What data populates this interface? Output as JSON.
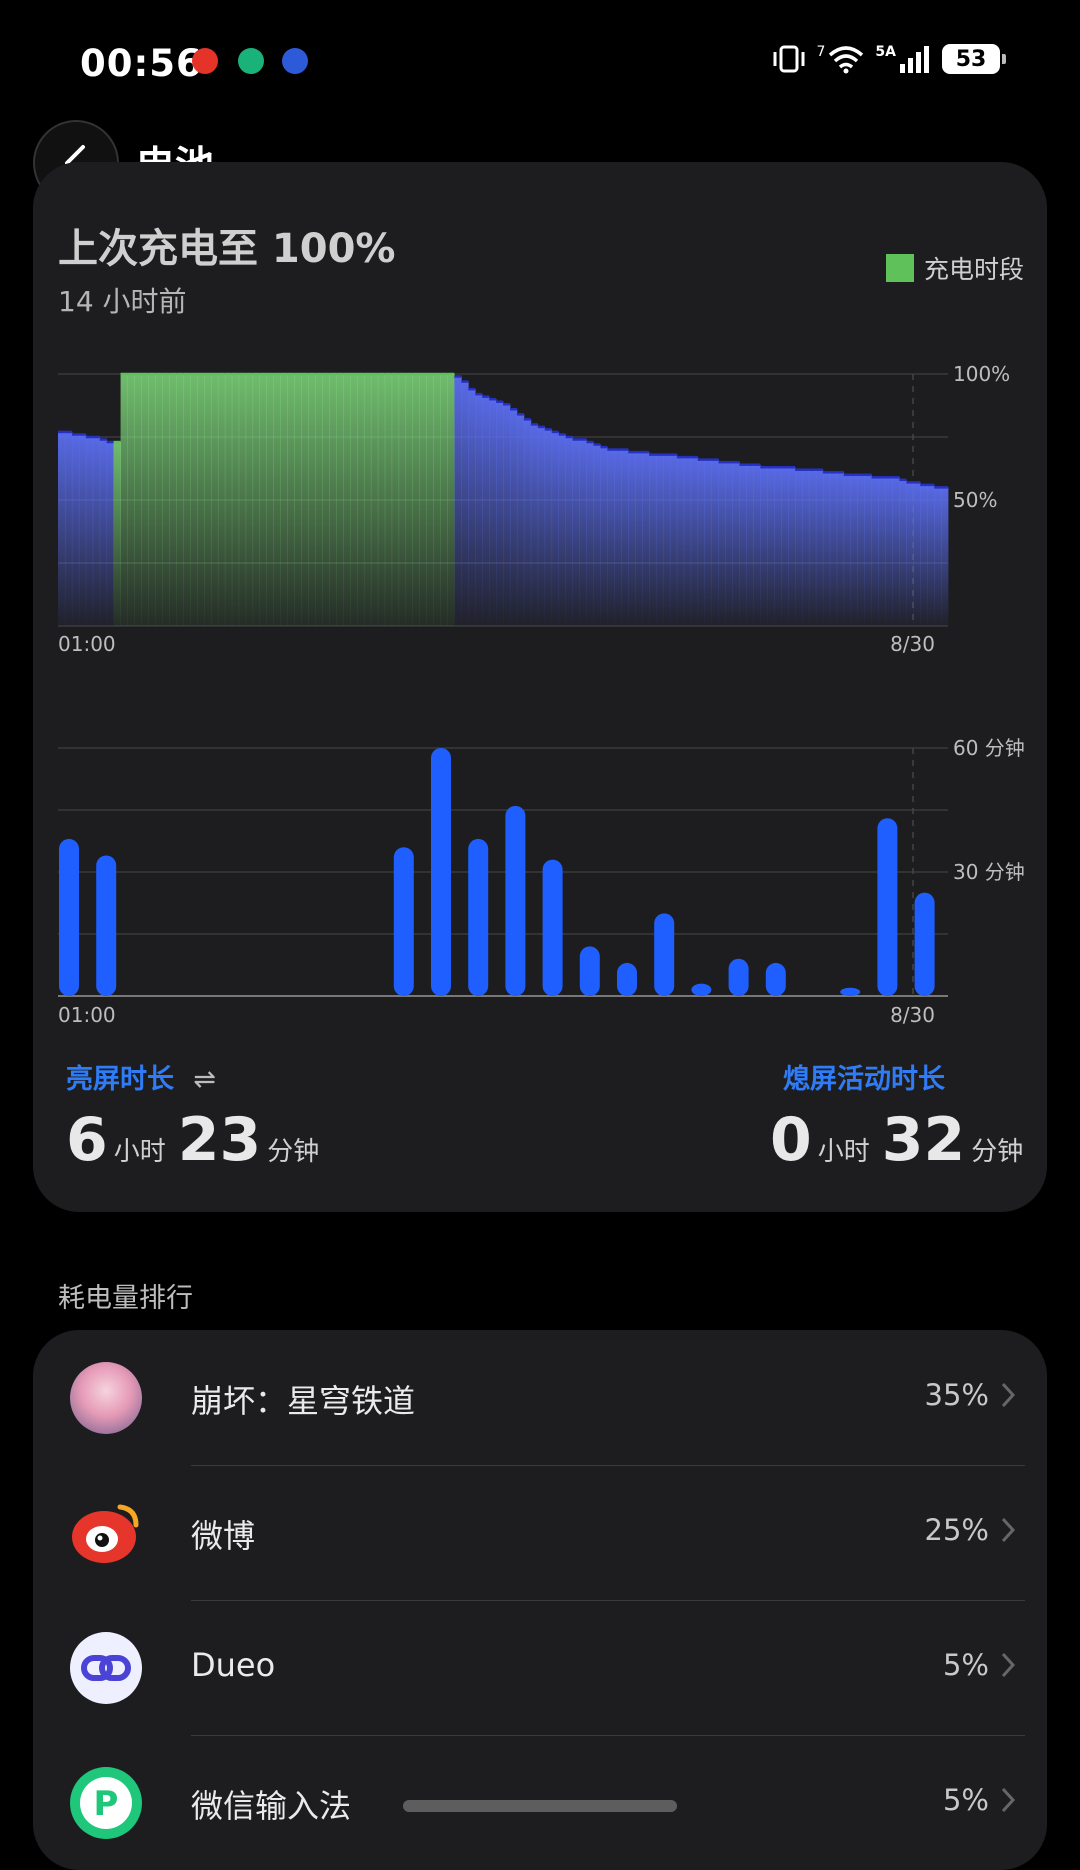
{
  "status_bar": {
    "time": "00:56",
    "signal_label": "5A",
    "wifi_label": "7",
    "battery_level": "53",
    "notification_icons": [
      "weibo-icon",
      "mi-home-icon",
      "link-icon"
    ]
  },
  "header": {
    "title": "电池",
    "back_icon": "chevron-left-icon"
  },
  "battery_card": {
    "last_charge_title": "上次充电至 100%",
    "last_charge_sub": "14 小时前",
    "legend_label": "充电时段",
    "legend_color": "#5ec15a",
    "screen_on_label": "亮屏时长",
    "screen_on_hours": "6",
    "screen_on_minutes": "23",
    "screen_off_label": "熄屏活动时长",
    "screen_off_hours": "0",
    "screen_off_minutes": "32",
    "hour_unit": "小时",
    "minute_unit": "分钟"
  },
  "chart_data": [
    {
      "type": "area",
      "x_start_label": "01:00",
      "x_end_label": "8/30",
      "y_tick_labels": [
        "100%",
        "50%"
      ],
      "ylim": [
        0,
        100
      ],
      "charging_color": "#5ec15a",
      "discharge_color": "#3d55d6",
      "values": [
        77,
        77,
        76,
        76,
        75,
        75,
        74,
        73,
        73,
        100,
        100,
        100,
        100,
        100,
        100,
        100,
        100,
        100,
        100,
        100,
        100,
        100,
        100,
        100,
        100,
        100,
        100,
        100,
        100,
        100,
        100,
        100,
        100,
        100,
        100,
        100,
        100,
        100,
        100,
        100,
        100,
        100,
        100,
        100,
        100,
        100,
        100,
        100,
        100,
        100,
        100,
        100,
        100,
        100,
        100,
        100,
        100,
        99,
        97,
        94,
        92,
        91,
        90,
        89,
        88,
        86,
        84,
        82,
        80,
        79,
        78,
        77,
        76,
        75,
        74,
        74,
        73,
        72,
        71,
        70,
        70,
        70,
        69,
        69,
        69,
        68,
        68,
        68,
        68,
        67,
        67,
        67,
        66,
        66,
        66,
        65,
        65,
        65,
        64,
        64,
        64,
        63,
        63,
        63,
        63,
        63,
        62,
        62,
        62,
        62,
        61,
        61,
        61,
        60,
        60,
        60,
        60,
        59,
        59,
        59,
        59,
        58,
        57,
        57,
        56,
        56,
        55,
        55
      ]
    },
    {
      "type": "bar",
      "x_start_label": "01:00",
      "x_end_label": "8/30",
      "y_tick_labels": [
        "60 分钟",
        "30 分钟"
      ],
      "ylim": [
        0,
        60
      ],
      "bar_color": "#1f5fff",
      "values": [
        38,
        34,
        0,
        0,
        0,
        0,
        0,
        0,
        0,
        36,
        60,
        38,
        46,
        33,
        12,
        8,
        20,
        3,
        9,
        8,
        0,
        2,
        43,
        25
      ]
    }
  ],
  "ranking": {
    "section_title": "耗电量排行",
    "apps": [
      {
        "name": "崩坏：星穹铁道",
        "percent": "35%",
        "icon": "honkai-star-rail-icon"
      },
      {
        "name": "微博",
        "percent": "25%",
        "icon": "weibo-icon"
      },
      {
        "name": "Dueo",
        "percent": "5%",
        "icon": "dueo-icon"
      },
      {
        "name": "微信输入法",
        "percent": "5%",
        "icon": "wechat-input-icon"
      }
    ]
  }
}
